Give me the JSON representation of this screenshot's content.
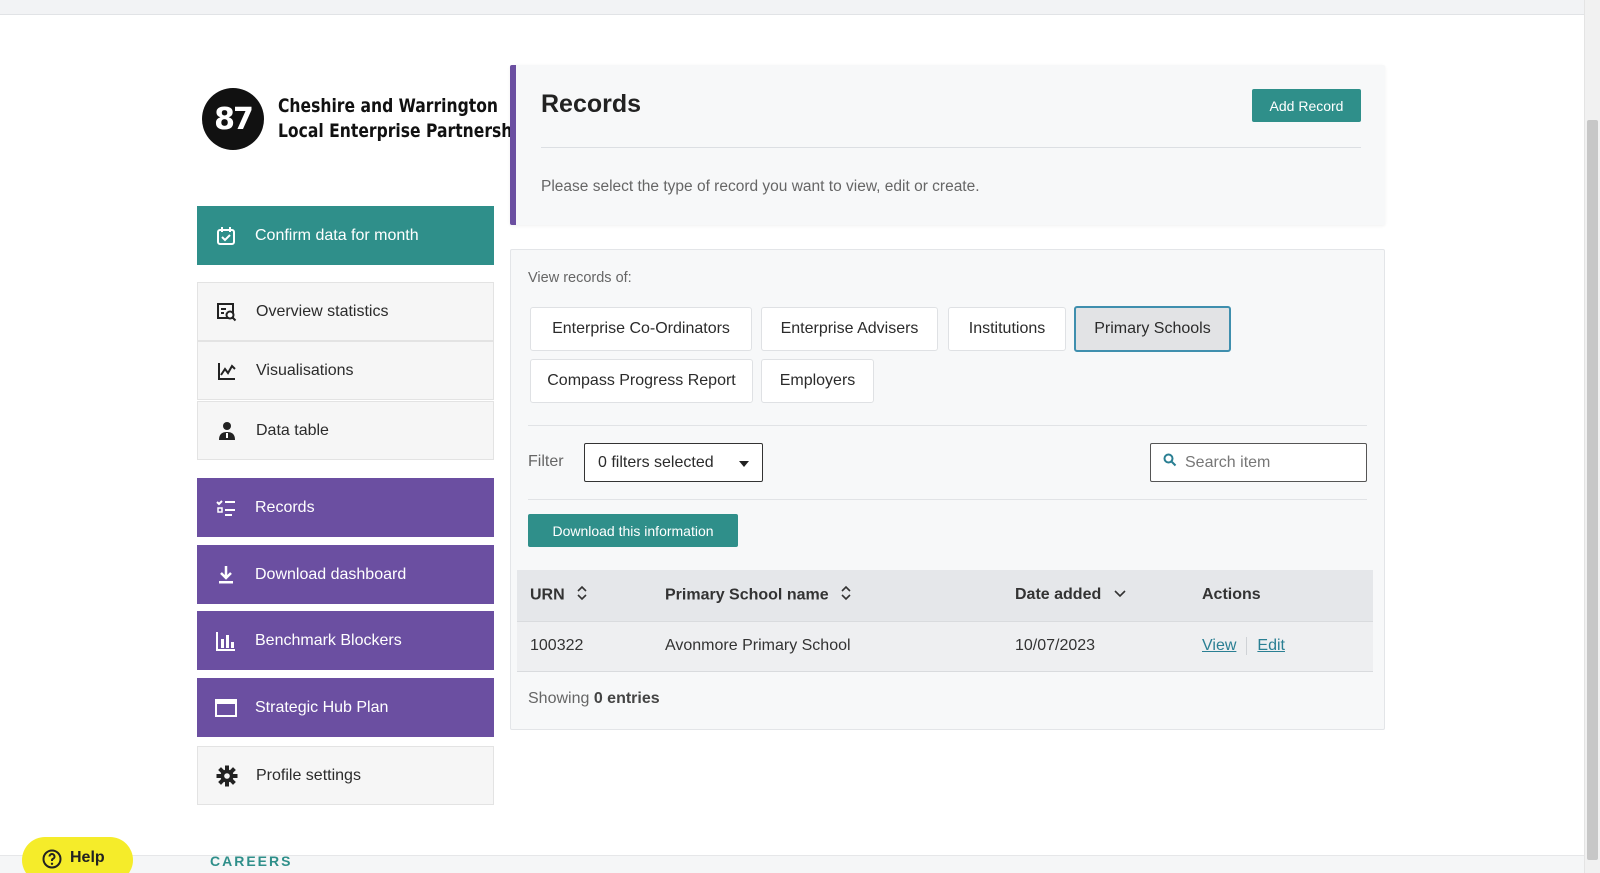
{
  "logo": {
    "badge": "87",
    "line1": "Cheshire and Warrington",
    "line2": "Local Enterprise Partnership"
  },
  "sidebar": {
    "items": [
      {
        "label": "Confirm data for month",
        "icon": "calendar-check-icon"
      },
      {
        "label": "Overview statistics",
        "icon": "search-report-icon"
      },
      {
        "label": "Visualisations",
        "icon": "chart-line-icon"
      },
      {
        "label": "Data table",
        "icon": "person-icon"
      },
      {
        "label": "Records",
        "icon": "list-check-icon"
      },
      {
        "label": "Download dashboard",
        "icon": "download-icon"
      },
      {
        "label": "Benchmark Blockers",
        "icon": "bar-chart-icon"
      },
      {
        "label": "Strategic Hub Plan",
        "icon": "window-icon"
      },
      {
        "label": "Profile settings",
        "icon": "gear-icon"
      }
    ]
  },
  "records": {
    "title": "Records",
    "add_label": "Add Record",
    "description": "Please select the type of record you want to view, edit or create."
  },
  "view": {
    "label": "View records of:",
    "types": [
      "Enterprise Co-Ordinators",
      "Enterprise Advisers",
      "Institutions",
      "Primary Schools",
      "Compass Progress Report",
      "Employers"
    ],
    "selected": "Primary Schools"
  },
  "filter": {
    "label": "Filter",
    "value": "0 filters selected"
  },
  "search": {
    "placeholder": "Search item"
  },
  "download_label": "Download this information",
  "table": {
    "columns": [
      "URN",
      "Primary School name",
      "Date added",
      "Actions"
    ],
    "rows": [
      {
        "urn": "100322",
        "name": "Avonmore Primary School",
        "date": "10/07/2023",
        "view": "View",
        "edit": "Edit"
      }
    ]
  },
  "showing": {
    "prefix": "Showing",
    "count": "0 entries"
  },
  "help_label": "Help",
  "footer_logo": "CAREERS"
}
